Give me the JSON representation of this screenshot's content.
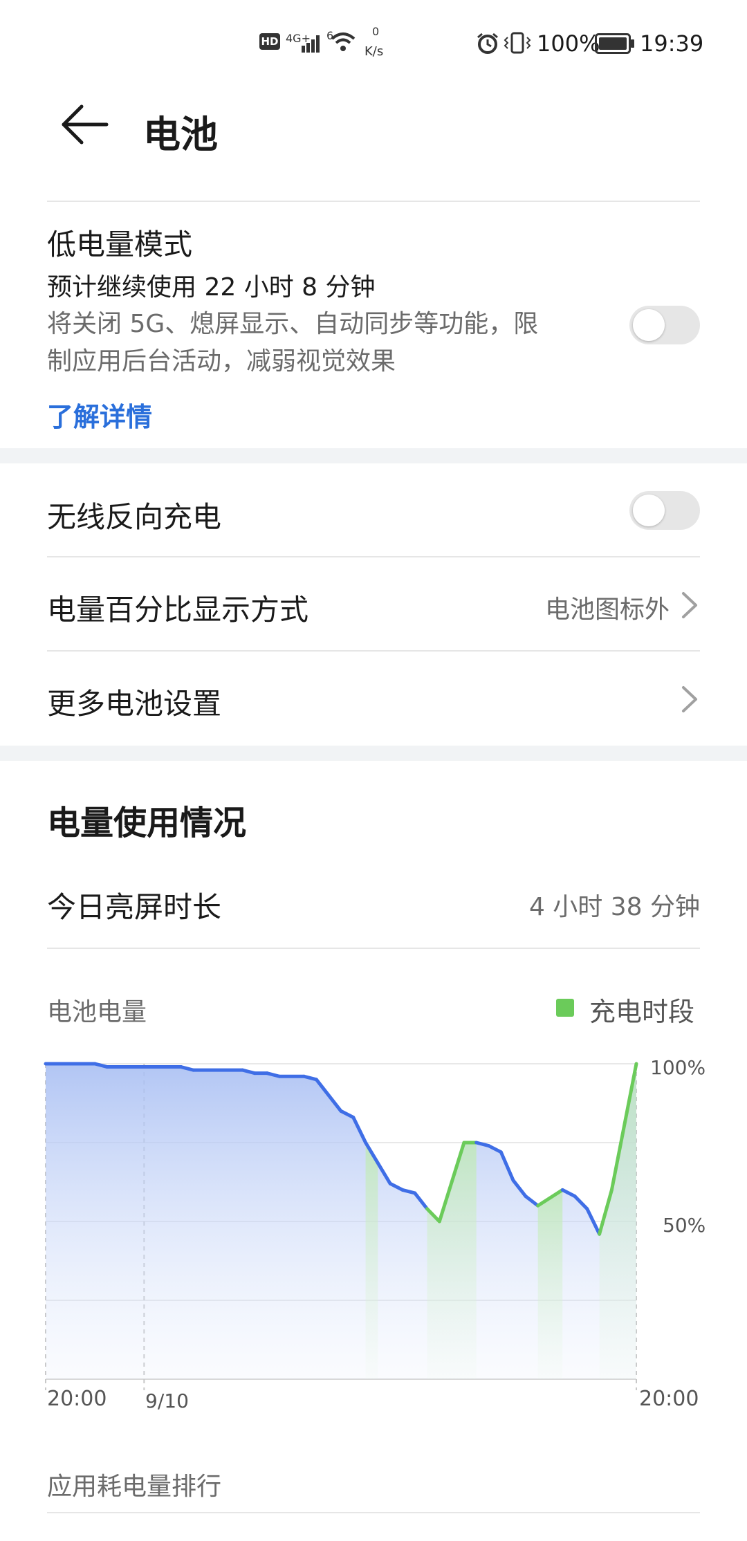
{
  "status_bar": {
    "hd": "HD",
    "network": "4G+",
    "wifi_label": "6",
    "speed_value": "0",
    "speed_unit": "K/s",
    "battery": "100%",
    "time": "19:39"
  },
  "header": {
    "title": "电池"
  },
  "low_power": {
    "title": "低电量模式",
    "estimate": "预计继续使用 22 小时 8 分钟",
    "desc_line1": "将关闭 5G、熄屏显示、自动同步等功能，限",
    "desc_line2": "制应用后台活动，减弱视觉效果",
    "link": "了解详情",
    "enabled": false
  },
  "wireless": {
    "title": "无线反向充电",
    "enabled": false
  },
  "percent_display": {
    "title": "电量百分比显示方式",
    "value": "电池图标外"
  },
  "more": {
    "title": "更多电池设置"
  },
  "usage": {
    "title": "电量使用情况",
    "screen_label": "今日亮屏时长",
    "screen_value": "4 小时 38 分钟"
  },
  "chart_label": "电池电量",
  "chart_legend": "充电时段",
  "ranking_title": "应用耗电量排行",
  "colors": {
    "accent": "#2a6fdb",
    "usage_line": "#3f6ee6",
    "charge_line": "#6bcb5a",
    "gap": "#f1f3f5"
  },
  "icons": {
    "back": "arrow-left-icon",
    "chevron": "chevron-right-icon",
    "alarm": "alarm-icon",
    "vibrate": "vibrate-icon",
    "wifi": "wifi-icon",
    "signal": "signal-icon",
    "battery": "battery-icon"
  },
  "chart_data": {
    "type": "line",
    "ylabel_ticks": [
      "100%",
      "50%"
    ],
    "x_ticks": [
      "20:00",
      "9/10",
      "20:00"
    ],
    "ylim": [
      0,
      100
    ],
    "xlim": [
      0,
      24
    ],
    "grid": true,
    "legend": "top-right",
    "series": [
      {
        "name": "充电时段",
        "type": "charging-segments",
        "values": [
          [
            13.0,
            75
          ],
          [
            13.5,
            68
          ],
          [
            15.5,
            54
          ],
          [
            16.0,
            50
          ],
          [
            17.0,
            75
          ],
          [
            17.5,
            75
          ],
          [
            20.0,
            55
          ],
          [
            21.0,
            60
          ],
          [
            22.5,
            46
          ],
          [
            23.0,
            60
          ],
          [
            24.0,
            100
          ]
        ]
      }
    ],
    "level": {
      "x": [
        0,
        2,
        2.5,
        5.5,
        6,
        8,
        8.5,
        9,
        9.5,
        10.5,
        11,
        12,
        12.5,
        13,
        14,
        14.5,
        15,
        15.5,
        16,
        17,
        17.5,
        18,
        18.5,
        19,
        19.5,
        20,
        21,
        21.5,
        22,
        22.5,
        23,
        24
      ],
      "y": [
        100,
        100,
        99,
        99,
        98,
        98,
        97,
        97,
        96,
        96,
        95,
        85,
        83,
        75,
        62,
        60,
        59,
        54,
        50,
        75,
        75,
        74,
        72,
        63,
        58,
        55,
        60,
        58,
        54,
        46,
        60,
        100
      ]
    },
    "charging_ranges": [
      [
        13,
        13.5
      ],
      [
        15.5,
        17.5
      ],
      [
        20,
        21
      ],
      [
        22.5,
        24
      ]
    ]
  }
}
